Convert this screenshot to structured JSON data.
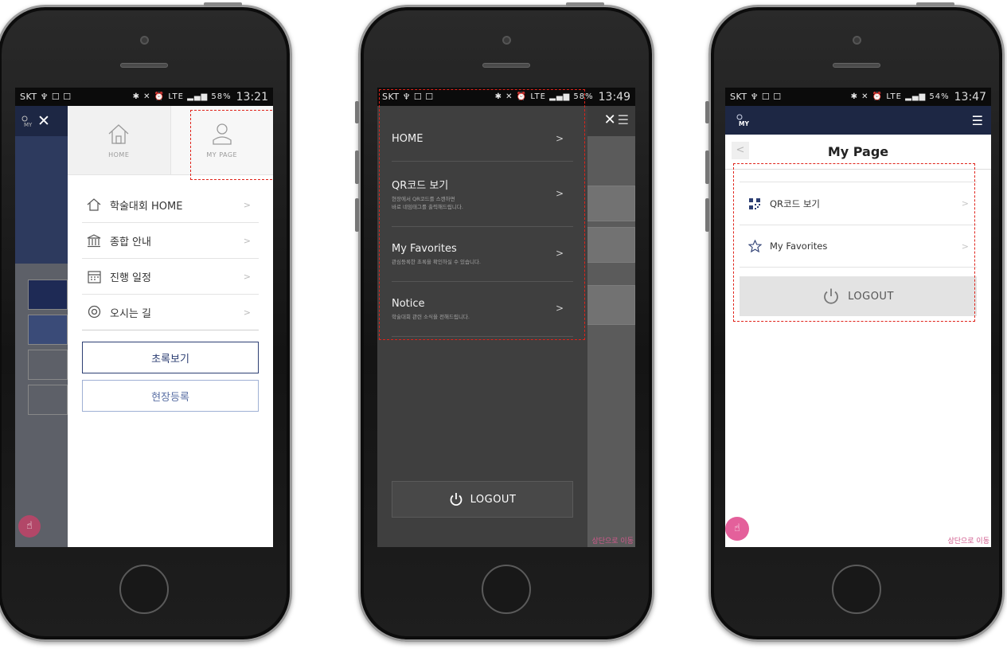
{
  "statusbar": {
    "carrier": "SKT",
    "left_icons": "♆ ☐ ☐",
    "p1": {
      "icons": "✱ ✕ ⏰ LTE ▂▄▆ 58%",
      "time": "13:21"
    },
    "p2": {
      "icons": "✱ ✕ ⏰ LTE ▂▄▆ 58%",
      "time": "13:49"
    },
    "p3": {
      "icons": "✱ ✕ ⏰ LTE ▂▄▆ 54%",
      "time": "13:47"
    }
  },
  "phone1": {
    "tabs": [
      {
        "label": "HOME",
        "icon": "house-icon"
      },
      {
        "label": "MY PAGE",
        "icon": "person-icon"
      }
    ],
    "menu": [
      {
        "label": "학술대회 HOME",
        "icon": "house-outline-icon"
      },
      {
        "label": "종합 안내",
        "icon": "building-icon"
      },
      {
        "label": "진행 일정",
        "icon": "calendar-icon"
      },
      {
        "label": "오시는 길",
        "icon": "location-pin-icon"
      }
    ],
    "buttons": {
      "abstract": "초록보기",
      "onsite": "현장등록"
    }
  },
  "phone2": {
    "menu": [
      {
        "title": "HOME",
        "sub": ""
      },
      {
        "title": "QR코드 보기",
        "sub": "현장에서 QR코드를 스캔하면\n바로 네임태그를 출력해드립니다."
      },
      {
        "title": "My Favorites",
        "sub": "관심등록한 초록을 확인하실 수 있습니다."
      },
      {
        "title": "Notice",
        "sub": "학술대회 관련 소식을 전해드립니다."
      }
    ],
    "logout": "LOGOUT",
    "scroll_top": "상단으로 이동"
  },
  "phone3": {
    "title": "My Page",
    "menu": [
      {
        "label": "QR코드 보기",
        "icon": "qr-code-icon"
      },
      {
        "label": "My Favorites",
        "icon": "star-outline-icon"
      }
    ],
    "logout": "LOGOUT",
    "scroll_top": "상단으로 이동"
  },
  "colors": {
    "navy_header": "#1d2744",
    "drawer_dark": "#3f3f3f",
    "highlight_dash": "#e0241b",
    "button_border": "#2d3f73",
    "fab_pink": "#e4609b"
  }
}
